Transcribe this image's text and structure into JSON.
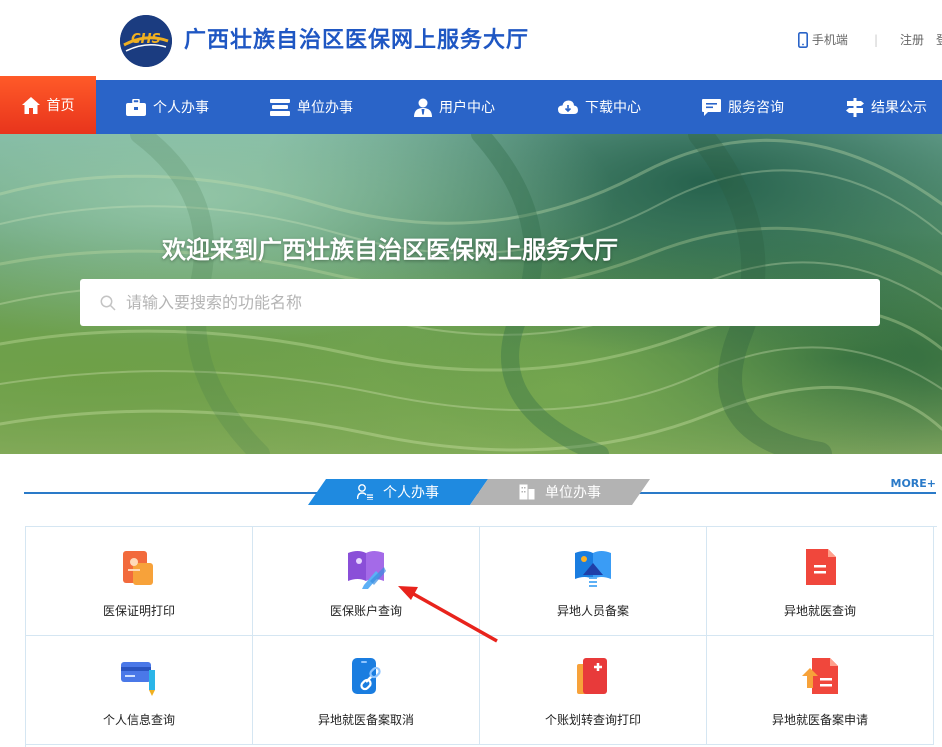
{
  "header": {
    "site_title": "广西壮族自治区医保网上服务大厅",
    "logo_text": "CHS",
    "mobile_label": "手机端",
    "separator": "|",
    "register_label": "注册",
    "login_label": "登"
  },
  "nav": {
    "items": [
      {
        "label": "首页",
        "icon": "home-icon"
      },
      {
        "label": "个人办事",
        "icon": "briefcase-icon"
      },
      {
        "label": "单位办事",
        "icon": "stack-icon"
      },
      {
        "label": "用户中心",
        "icon": "user-icon"
      },
      {
        "label": "下载中心",
        "icon": "cloud-download-icon"
      },
      {
        "label": "服务咨询",
        "icon": "chat-icon"
      },
      {
        "label": "结果公示",
        "icon": "signpost-icon"
      }
    ]
  },
  "banner": {
    "title": "欢迎来到广西壮族自治区医保网上服务大厅",
    "search_placeholder": "请输入要搜索的功能名称"
  },
  "tabs": {
    "personal": "个人办事",
    "unit": "单位办事",
    "more": "MORE+"
  },
  "services": [
    {
      "label": "医保证明打印",
      "icon": "certificate-print-icon"
    },
    {
      "label": "医保账户查询",
      "icon": "account-book-icon"
    },
    {
      "label": "异地人员备案",
      "icon": "remote-filing-icon"
    },
    {
      "label": "异地就医查询",
      "icon": "document-query-icon"
    },
    {
      "label": "个人信息查询",
      "icon": "card-pen-icon"
    },
    {
      "label": "异地就医备案取消",
      "icon": "phone-link-icon"
    },
    {
      "label": "个账划转查询打印",
      "icon": "book-plus-icon"
    },
    {
      "label": "异地就医备案申请",
      "icon": "upload-document-icon"
    }
  ],
  "colors": {
    "brand_blue": "#2a64c8",
    "title_blue": "#1f57c3",
    "home_red": "#ff5a28",
    "tab_active": "#1f8ae0",
    "tab_inactive": "#b3b3b3",
    "annotation_arrow": "#e8231c"
  }
}
